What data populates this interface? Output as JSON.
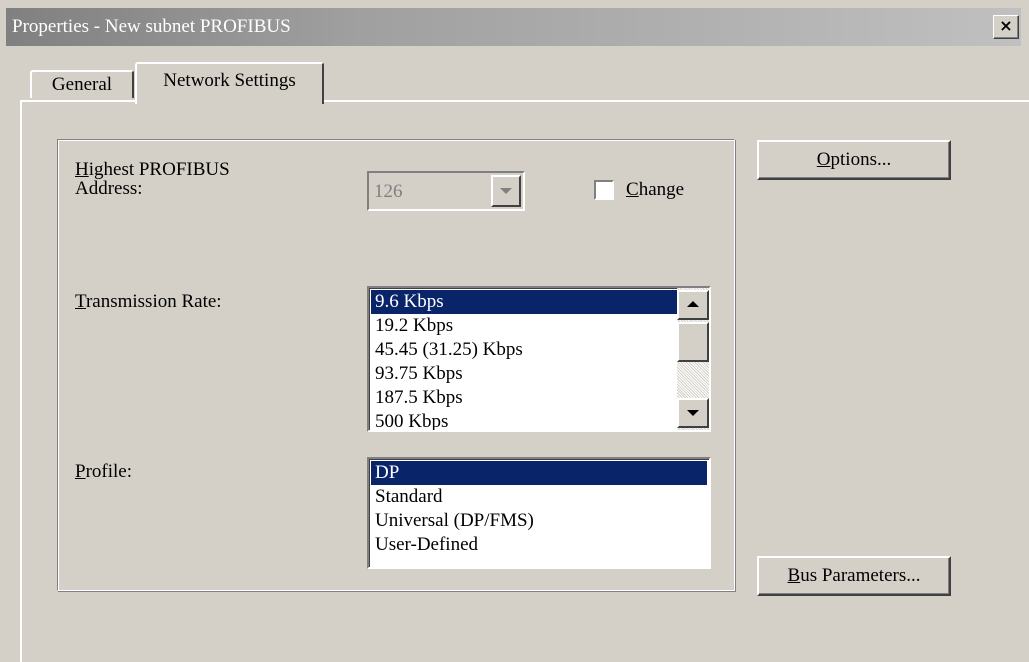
{
  "window": {
    "title": "Properties -  New subnet PROFIBUS",
    "close_label": "×"
  },
  "tabs": [
    {
      "label": "General",
      "active": false
    },
    {
      "label": "Network Settings",
      "active": true
    }
  ],
  "settings": {
    "highest_address_label_line1_accel": "H",
    "highest_address_label_line1_rest": "ighest PROFIBUS",
    "highest_address_label_line2": "Address:",
    "highest_address_value": "126",
    "change_checkbox_accel": "C",
    "change_checkbox_rest": "hange",
    "change_checked": false,
    "transmission_rate_label_accel": "T",
    "transmission_rate_label_rest": "ransmission Rate:",
    "transmission_rates": [
      "9.6 Kbps",
      "19.2 Kbps",
      "45.45 (31.25) Kbps",
      "93.75 Kbps",
      "187.5 Kbps",
      "500 Kbps"
    ],
    "transmission_rate_selected": "9.6 Kbps",
    "profile_label_accel": "P",
    "profile_label_rest": "rofile:",
    "profiles": [
      "DP",
      "Standard",
      "Universal (DP/FMS)",
      "User-Defined"
    ],
    "profile_selected": "DP"
  },
  "buttons": {
    "options_accel": "O",
    "options_rest": "ptions...",
    "bus_parameters_accel": "B",
    "bus_parameters_rest": "us Parameters..."
  },
  "colors": {
    "face": "#d4d0c8",
    "selection": "#0a246a",
    "title_gradient_start": "#808080"
  }
}
